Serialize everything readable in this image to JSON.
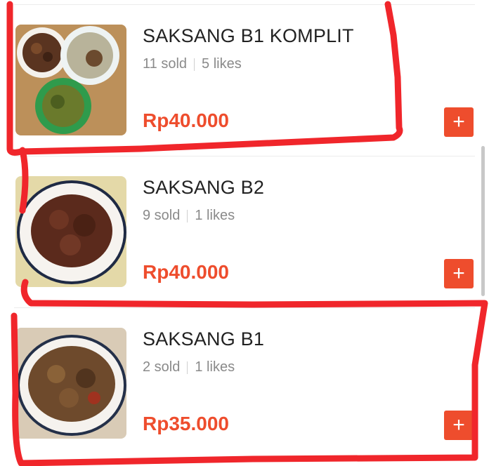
{
  "products": [
    {
      "name": "SAKSANG B1 KOMPLIT",
      "sold": "11 sold",
      "likes": "5 likes",
      "price": "Rp40.000",
      "add_label": "+"
    },
    {
      "name": "SAKSANG B2",
      "sold": "9 sold",
      "likes": "1 likes",
      "price": "Rp40.000",
      "add_label": "+"
    },
    {
      "name": "SAKSANG B1",
      "sold": "2 sold",
      "likes": "1 likes",
      "price": "Rp35.000",
      "add_label": "+"
    }
  ],
  "colors": {
    "accent": "#ee4d2d",
    "annotation": "#f0262b"
  },
  "icons": {
    "add": "plus-icon"
  }
}
